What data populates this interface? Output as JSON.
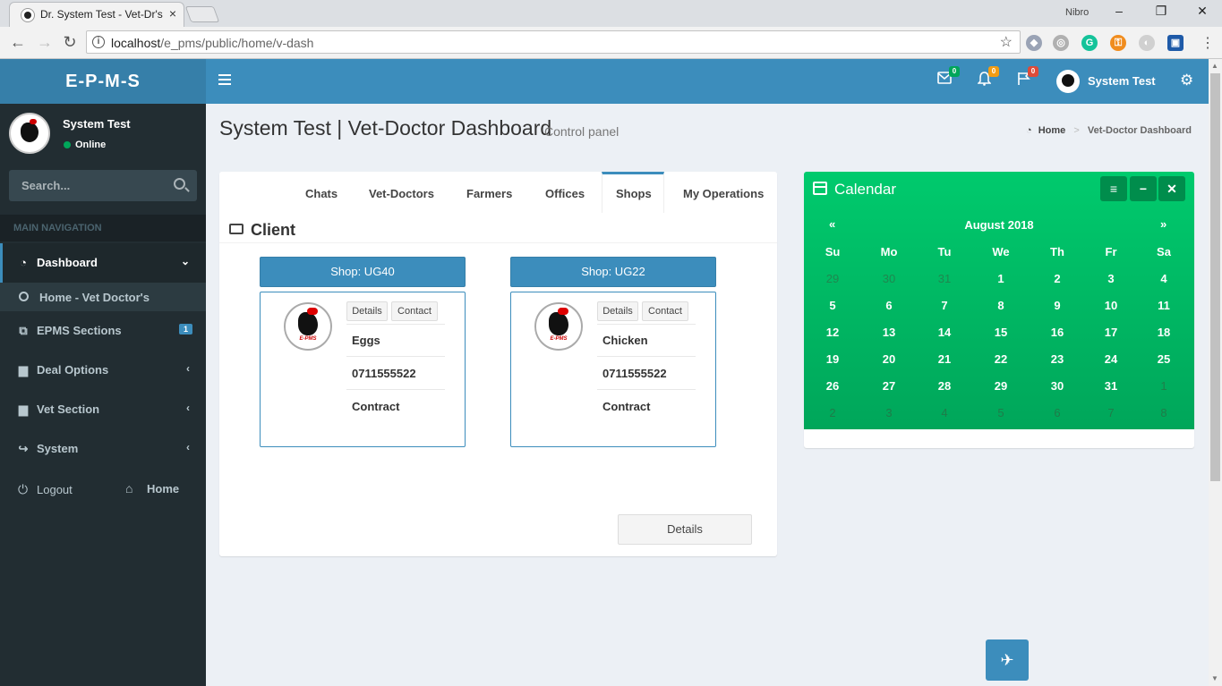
{
  "browser": {
    "tab_title": "Dr. System Test - Vet-Dr's",
    "tab_close": "×",
    "profile": "Nibro",
    "url_host": "localhost",
    "url_path": "/e_pms/public/home/v-dash",
    "min": "–",
    "restore": "❐",
    "close": "✕"
  },
  "app": {
    "logo": "E-P-M-S",
    "header": {
      "messages_count": "0",
      "notifications_count": "0",
      "flags_count": "0",
      "user_name": "System Test",
      "colors": {
        "green": "#00a65a",
        "yellow": "#f39c12",
        "red": "#dd4b39"
      }
    },
    "sidebar": {
      "user_name": "System Test",
      "status": "Online",
      "search_placeholder": "Search...",
      "nav_header": "MAIN NAVIGATION",
      "items": [
        {
          "label": "Dashboard",
          "icon": "dashboard-icon",
          "caret": "⌄"
        },
        {
          "label": "Home - Vet Doctor's",
          "icon": "circle-o-icon"
        },
        {
          "label": "EPMS Sections",
          "icon": "copy-icon",
          "badge": "1"
        },
        {
          "label": "Deal Options",
          "icon": "folder-icon",
          "caret": "‹"
        },
        {
          "label": "Vet Section",
          "icon": "folder-icon",
          "caret": "‹"
        },
        {
          "label": "System",
          "icon": "share-icon",
          "caret": "‹"
        }
      ],
      "logout": "Logout",
      "home": "Home"
    },
    "content": {
      "title": "System Test | Vet-Doctor Dashboard",
      "subtitle": "Control panel",
      "breadcrumb": {
        "home": "Home",
        "current": "Vet-Doctor Dashboard"
      },
      "tabs": [
        "Chats",
        "Vet-Doctors",
        "Farmers",
        "Offices",
        "Shops",
        "My Operations"
      ],
      "active_tab": "Shops",
      "section_title": "Client",
      "shops": [
        {
          "header": "Shop: UG40",
          "details_btn": "Details",
          "contact_btn": "Contact",
          "product": "Eggs",
          "phone": "0711555522",
          "contract": "Contract",
          "logo_text": "E-PMS"
        },
        {
          "header": "Shop: UG22",
          "details_btn": "Details",
          "contact_btn": "Contact",
          "product": "Chicken",
          "phone": "0711555522",
          "contract": "Contract",
          "logo_text": "E-PMS"
        }
      ],
      "details_button": "Details"
    },
    "calendar": {
      "title": "Calendar",
      "month": "August 2018",
      "prev": "«",
      "next": "»",
      "days_of_week": [
        "Su",
        "Mo",
        "Tu",
        "We",
        "Th",
        "Fr",
        "Sa"
      ],
      "weeks": [
        [
          "29",
          "30",
          "31",
          "1",
          "2",
          "3",
          "4"
        ],
        [
          "5",
          "6",
          "7",
          "8",
          "9",
          "10",
          "11"
        ],
        [
          "12",
          "13",
          "14",
          "15",
          "16",
          "17",
          "18"
        ],
        [
          "19",
          "20",
          "21",
          "22",
          "23",
          "24",
          "25"
        ],
        [
          "26",
          "27",
          "28",
          "29",
          "30",
          "31",
          "1"
        ],
        [
          "2",
          "3",
          "4",
          "5",
          "6",
          "7",
          "8"
        ]
      ],
      "muted": [
        [
          0,
          0
        ],
        [
          0,
          1
        ],
        [
          0,
          2
        ],
        [
          4,
          6
        ],
        [
          5,
          0
        ],
        [
          5,
          1
        ],
        [
          5,
          2
        ],
        [
          5,
          3
        ],
        [
          5,
          4
        ],
        [
          5,
          5
        ],
        [
          5,
          6
        ]
      ],
      "tools": [
        "≡",
        "−",
        "✕"
      ]
    },
    "fab_icon": "plane-icon"
  }
}
